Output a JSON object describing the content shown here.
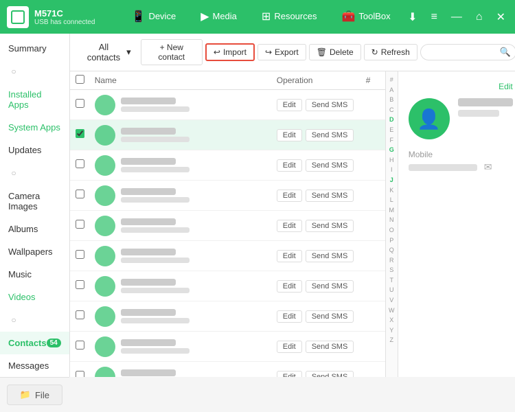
{
  "titlebar": {
    "device_name": "M571C",
    "device_sub": "USB has connected",
    "nav_items": [
      {
        "label": "Device",
        "icon": "📱"
      },
      {
        "label": "Media",
        "icon": "▶"
      },
      {
        "label": "Resources",
        "icon": "⊞"
      },
      {
        "label": "ToolBox",
        "icon": "🧰"
      }
    ],
    "right_btns": [
      "⬇",
      "≡",
      "—",
      "⌂",
      "✕"
    ]
  },
  "sidebar": {
    "items": [
      {
        "label": "Summary",
        "active": false
      },
      {
        "label": "",
        "icon_only": true
      },
      {
        "label": "Installed Apps",
        "active": false,
        "green": true
      },
      {
        "label": "System Apps",
        "active": false,
        "green": true
      },
      {
        "label": "Updates",
        "active": false
      },
      {
        "label": "",
        "icon_only": true
      },
      {
        "label": "Camera Images",
        "active": false
      },
      {
        "label": "Albums",
        "active": false
      },
      {
        "label": "Wallpapers",
        "active": false
      },
      {
        "label": "Music",
        "active": false
      },
      {
        "label": "Videos",
        "active": false,
        "green": true
      },
      {
        "label": "",
        "icon_only": true
      },
      {
        "label": "Contacts",
        "active": true,
        "badge": "54"
      },
      {
        "label": "Messages",
        "active": false
      }
    ],
    "file_btn": "File"
  },
  "toolbar": {
    "all_contacts": "All contacts",
    "new_contact": "+ New contact",
    "import": "Import",
    "export": "Export",
    "delete": "Delete",
    "refresh": "Refresh",
    "search_placeholder": ""
  },
  "table": {
    "col_name": "Name",
    "col_operation": "Operation",
    "edit_label": "Edit",
    "send_sms_label": "Send SMS",
    "rows": [
      {
        "selected": false,
        "checked": false
      },
      {
        "selected": true,
        "checked": true
      },
      {
        "selected": false,
        "checked": false
      },
      {
        "selected": false,
        "checked": false
      },
      {
        "selected": false,
        "checked": false
      },
      {
        "selected": false,
        "checked": false
      },
      {
        "selected": false,
        "checked": false
      },
      {
        "selected": false,
        "checked": false
      },
      {
        "selected": false,
        "checked": false
      },
      {
        "selected": false,
        "checked": false
      }
    ]
  },
  "alpha": [
    "#",
    "A",
    "B",
    "C",
    "D",
    "E",
    "F",
    "G",
    "H",
    "I",
    "J",
    "K",
    "L",
    "M",
    "N",
    "O",
    "P",
    "Q",
    "R",
    "S",
    "T",
    "U",
    "V",
    "W",
    "X",
    "Y",
    "Z"
  ],
  "alpha_active": [
    "G",
    "J",
    "D"
  ],
  "detail": {
    "edit_label": "Edit",
    "mobile_label": "Mobile"
  }
}
